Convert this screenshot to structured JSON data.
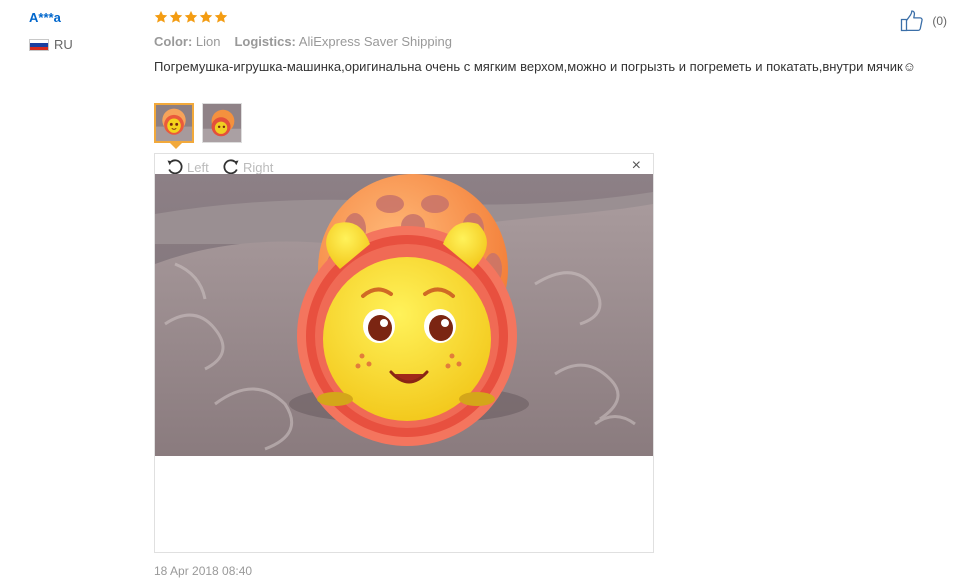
{
  "user": {
    "name": "A***a",
    "country": "RU",
    "flag_colors": [
      "#ffffff",
      "#1a3fa0",
      "#d52b1e"
    ]
  },
  "rating": {
    "stars": 5,
    "max": 5,
    "color": "#f39c12"
  },
  "helpful": {
    "count": "(0)"
  },
  "meta": {
    "color_label": "Color:",
    "color_value": "Lion",
    "logistics_label": "Logistics:",
    "logistics_value": "AliExpress Saver Shipping"
  },
  "review": {
    "text": "Погремушка-игрушка-машинка,оригинальна очень с мягким верхом,можно и погрызть и погреметь и покатать,внутри мячик☺"
  },
  "thumbnails": [
    {
      "active": true
    },
    {
      "active": false
    }
  ],
  "viewer": {
    "rotate_left_label": "Left",
    "rotate_right_label": "Right",
    "close_symbol": "×"
  },
  "date": "18 Apr 2018 08:40",
  "colors": {
    "link": "#0066cc",
    "accent": "#f2a93b"
  }
}
